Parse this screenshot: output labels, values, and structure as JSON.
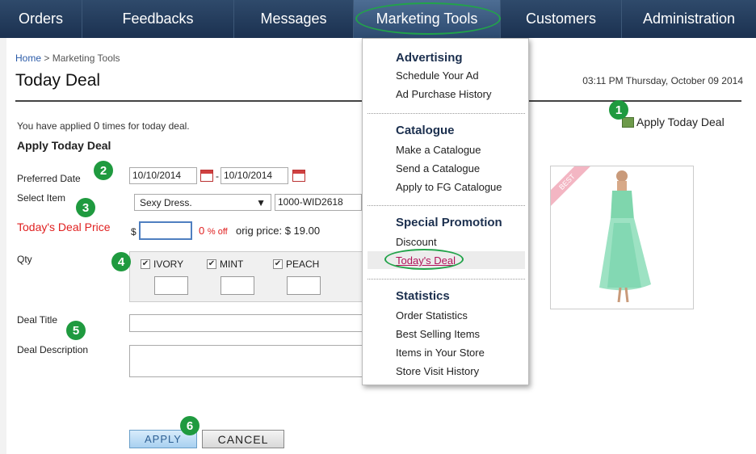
{
  "nav": {
    "items": [
      "Orders",
      "Feedbacks",
      "Messages",
      "Marketing Tools",
      "Customers",
      "Administration"
    ],
    "active": "Marketing Tools"
  },
  "breadcrumb": {
    "home": "Home",
    "separator": ">",
    "current": "Marketing Tools"
  },
  "page": {
    "title": "Today Deal",
    "datetime": "03:11 PM Thursday, October 09 2014"
  },
  "apply_link": "Apply Today Deal",
  "applied_note": {
    "prefix": "You have applied",
    "count": "0",
    "suffix": "times for today deal."
  },
  "form": {
    "heading": "Apply Today Deal",
    "preferred_date_label": "Preferred Date",
    "date_from": "10/10/2014",
    "date_separator": "-",
    "date_to": "10/10/2014",
    "select_item_label": "Select Item",
    "select_item_value": "Sexy Dress.",
    "item_code": "1000-WID2618",
    "price_label": "Today's Deal Price",
    "currency": "$",
    "price_value": "",
    "discount_value": "0",
    "discount_text": "% off",
    "orig_price_text": "orig price: $ 19.00",
    "qty_label": "Qty",
    "colors": [
      "IVORY",
      "MINT",
      "PEACH"
    ],
    "deal_title_label": "Deal Title",
    "deal_description_label": "Deal Description",
    "apply_button": "APPLY",
    "cancel_button": "CANCEL"
  },
  "product": {
    "ribbon": "BEST"
  },
  "badges": [
    "1",
    "2",
    "3",
    "4",
    "5",
    "6"
  ],
  "dropdown": {
    "groups": [
      {
        "title": "Advertising",
        "items": [
          "Schedule Your Ad",
          "Ad Purchase History"
        ]
      },
      {
        "title": "Catalogue",
        "items": [
          "Make a Catalogue",
          "Send a Catalogue",
          "Apply to FG Catalogue"
        ]
      },
      {
        "title": "Special Promotion",
        "items": [
          "Discount",
          "Today's Deal"
        ]
      },
      {
        "title": "Statistics",
        "items": [
          "Order Statistics",
          "Best Selling Items",
          "Items in Your Store",
          "Store Visit History"
        ]
      }
    ],
    "current_item": "Today's Deal"
  },
  "colors": {
    "nav_bg": "#1b3150",
    "highlight_oval": "#22a34a",
    "badge": "#1f9a3f",
    "alert_red": "#e02020"
  }
}
